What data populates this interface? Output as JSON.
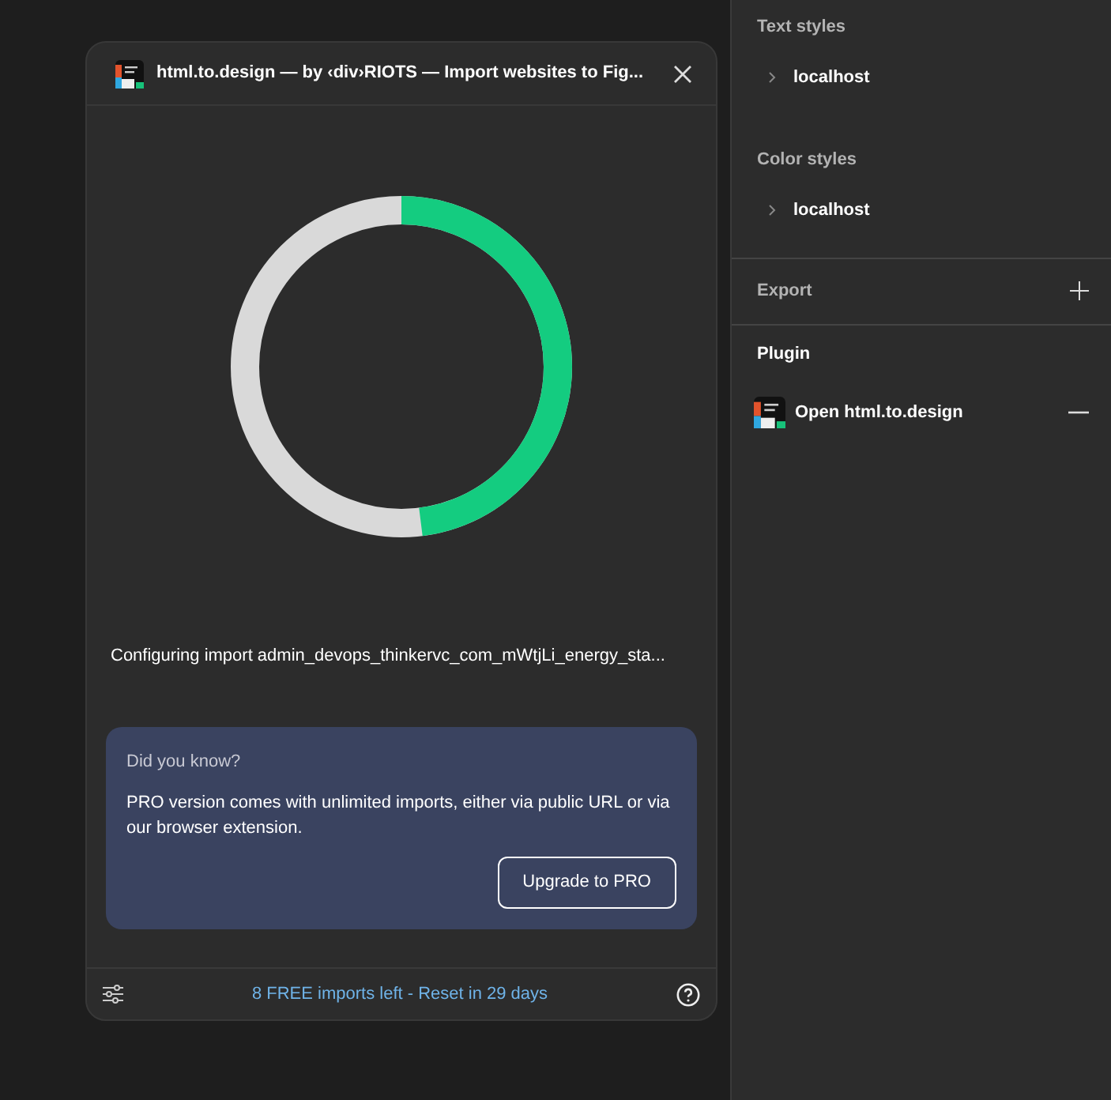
{
  "plugin_window": {
    "title": "html.to.design — by ‹div›RIOTS — Import websites to Fig...",
    "progress": {
      "level": 0.48
    },
    "status": "Configuring import admin_devops_thinkervc_com_mWtjLi_energy_sta...",
    "tip": {
      "heading": "Did you know?",
      "text": "PRO version comes with unlimited imports, either via public URL or via our browser extension.",
      "button": "Upgrade to PRO"
    },
    "footer": {
      "quota": "8 FREE imports left - Reset in 29 days"
    }
  },
  "right_panel": {
    "sections": [
      {
        "title": "Text styles",
        "items": [
          {
            "label": "localhost",
            "expanded": false
          }
        ]
      },
      {
        "title": "Color styles",
        "items": [
          {
            "label": "localhost",
            "expanded": false
          }
        ]
      }
    ],
    "export": {
      "title": "Export"
    },
    "plugin": {
      "title": "Plugin",
      "item": "Open html.to.design"
    }
  }
}
